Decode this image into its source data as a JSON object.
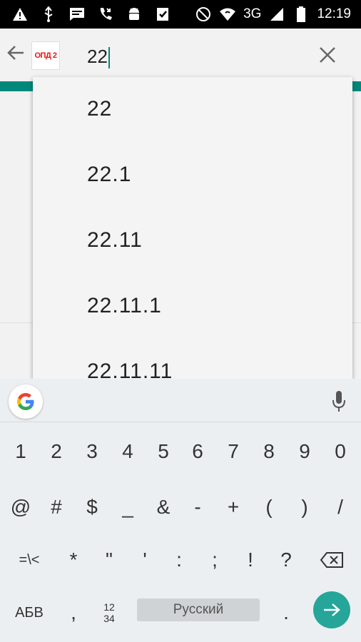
{
  "status_bar": {
    "network": "3G",
    "time": "12:19"
  },
  "app_bar": {
    "logo_text": "ОПД 2",
    "search_query": "22"
  },
  "suggestions": [
    "22",
    "22.1",
    "22.11",
    "22.11.1",
    "22.11.11"
  ],
  "keyboard": {
    "row1": [
      "1",
      "2",
      "3",
      "4",
      "5",
      "6",
      "7",
      "8",
      "9",
      "0"
    ],
    "row2": [
      "@",
      "#",
      "$",
      "_",
      "&",
      "-",
      "+",
      "(",
      ")",
      "/"
    ],
    "row3_left": "=\\<",
    "row3": [
      "*",
      "\"",
      "'",
      ":",
      ";",
      "!",
      "?"
    ],
    "row4": {
      "abc": "АБВ",
      "comma": ",",
      "layout_switch": "12\n34",
      "space": "Русский",
      "period": "."
    }
  }
}
